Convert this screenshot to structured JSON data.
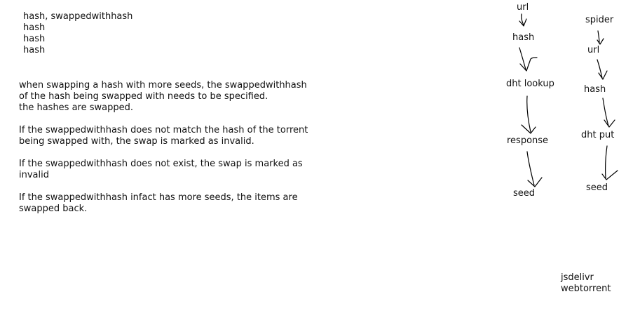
{
  "hash_list": [
    "hash, swappedwithhash",
    "hash",
    "hash",
    "hash"
  ],
  "notes": [
    [
      "when swapping a hash with more seeds, the swappedwithhash",
      "of the hash being swapped with needs to be specified.",
      "the hashes are swapped."
    ],
    [
      "If the swappedwithhash does not match the hash of the torrent",
      "being swapped with, the swap is marked as invalid."
    ],
    [
      "If the swappedwithhash does not exist, the swap is marked as",
      "invalid"
    ],
    [
      "If the swappedwithhash infact has more seeds, the items are",
      "swapped back."
    ]
  ],
  "flow_left": [
    "url",
    "hash",
    "dht lookup",
    "response",
    "seed"
  ],
  "flow_right": [
    "spider",
    "url",
    "hash",
    "dht put",
    "seed"
  ],
  "libraries": [
    "jsdelivr",
    "webtorrent"
  ]
}
